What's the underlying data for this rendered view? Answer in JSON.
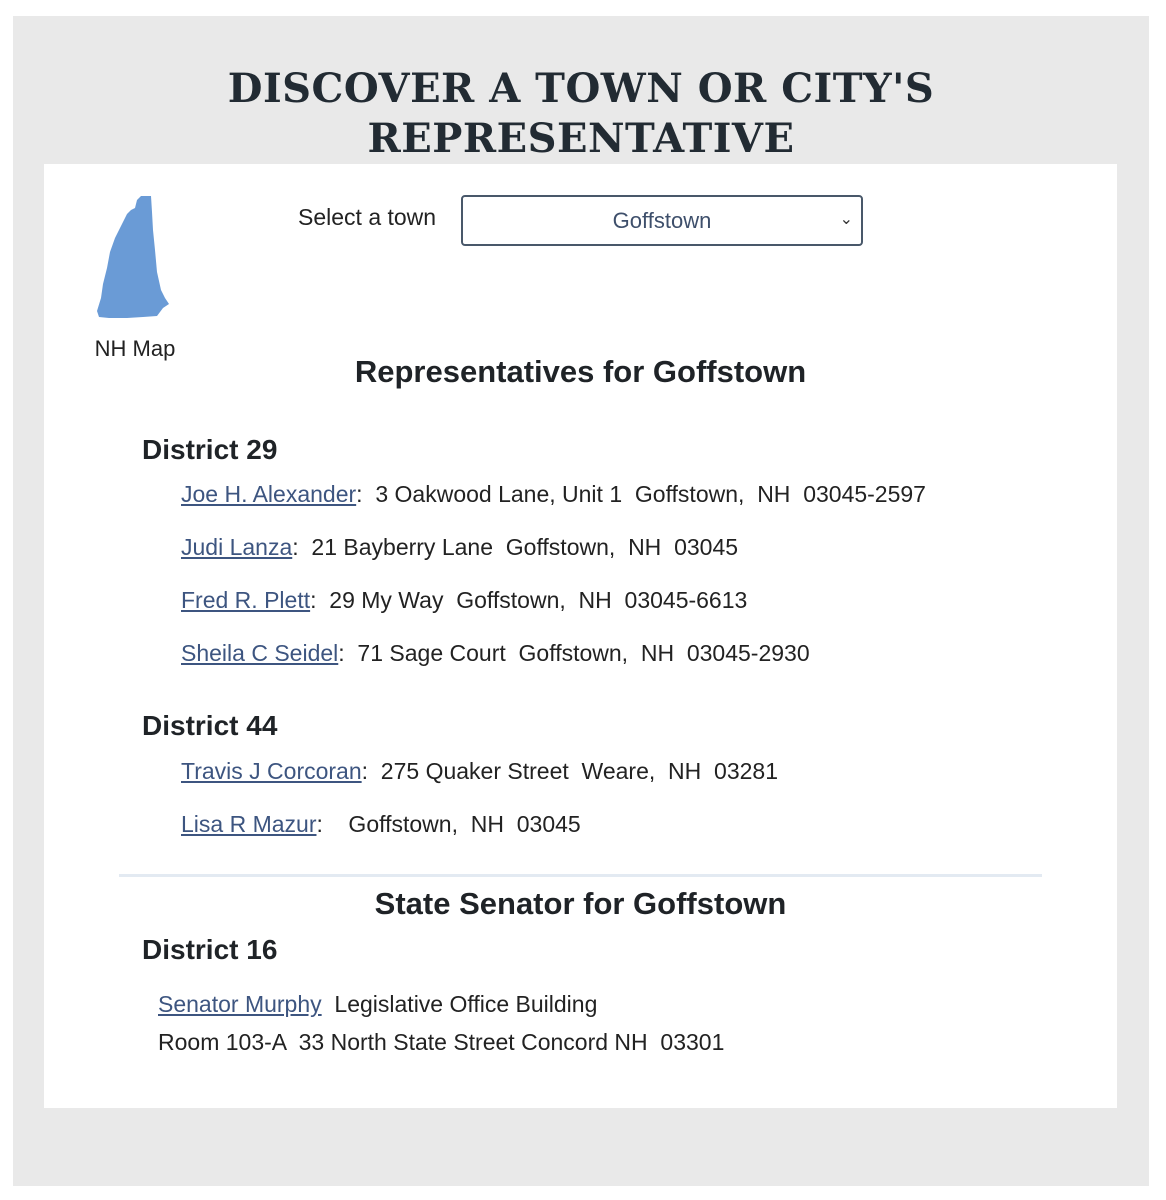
{
  "page_title": [
    "DISCOVER A TOWN OR CITY'S",
    "REPRESENTATIVE"
  ],
  "map": {
    "label": "NH Map",
    "icon": "nh-state-map-icon",
    "fill": "#6a9bd6"
  },
  "town_select": {
    "label": "Select a town",
    "value": "Goffstown"
  },
  "representatives": {
    "title": "Representatives for Goffstown",
    "districts": [
      {
        "name": "District 29",
        "members": [
          {
            "name": "Joe H. Alexander",
            "address": ":  3 Oakwood Lane, Unit 1  Goffstown,  NH  03045-2597"
          },
          {
            "name": "Judi Lanza",
            "address": ":  21 Bayberry Lane  Goffstown,  NH  03045"
          },
          {
            "name": "Fred R. Plett",
            "address": ":  29 My Way  Goffstown,  NH  03045-6613"
          },
          {
            "name": "Sheila C Seidel",
            "address": ":  71 Sage Court  Goffstown,  NH  03045-2930"
          }
        ]
      },
      {
        "name": "District 44",
        "members": [
          {
            "name": "Travis J Corcoran",
            "address": ":  275 Quaker Street  Weare,  NH  03281"
          },
          {
            "name": "Lisa R Mazur",
            "address": ":    Goffstown,  NH  03045"
          }
        ]
      }
    ]
  },
  "senator": {
    "title": "State Senator for Goffstown",
    "district": "District 16",
    "name": "Senator Murphy",
    "address_line1": "  Legislative Office Building",
    "address_line2": "Room 103-A  33 North State Street Concord NH  03301"
  },
  "colors": {
    "link": "#3d5580",
    "outer_bg": "#e9e9e9",
    "select_border": "#49586a"
  }
}
